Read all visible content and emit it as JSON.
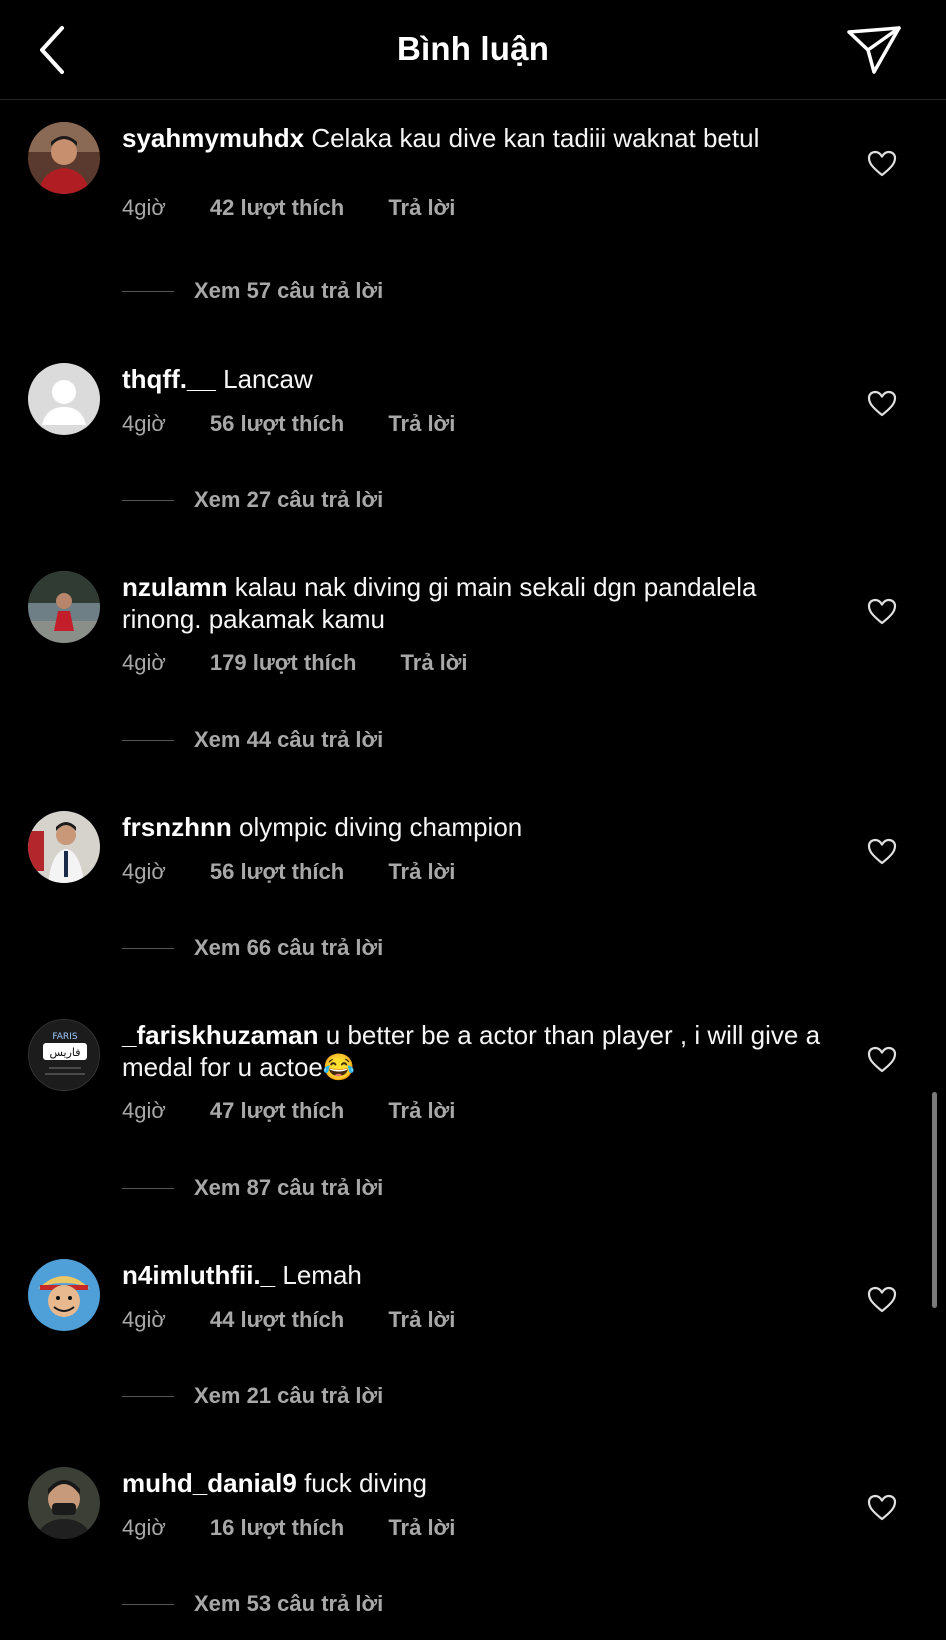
{
  "header": {
    "title": "Bình luận"
  },
  "actions": {
    "like_suffix": "lượt thích",
    "reply_label": "Trả lời"
  },
  "comments": [
    {
      "user": "syahmymuhdx",
      "text": "Celaka kau dive kan tadiii waknat betul",
      "time": "4giờ",
      "likes": "42 lượt thích",
      "reply": "Trả lời",
      "view_replies": "Xem 57 câu trả lời"
    },
    {
      "user": "thqff.__",
      "text": "Lancaw",
      "time": "4giờ",
      "likes": "56 lượt thích",
      "reply": "Trả lời",
      "view_replies": "Xem 27 câu trả lời"
    },
    {
      "user": "nzulamn",
      "text": "kalau nak diving gi main sekali dgn pandalela rinong. pakamak kamu",
      "time": "4giờ",
      "likes": "179 lượt thích",
      "reply": "Trả lời",
      "view_replies": "Xem 44 câu trả lời"
    },
    {
      "user": "frsnzhnn",
      "text": "olympic diving champion",
      "time": "4giờ",
      "likes": "56 lượt thích",
      "reply": "Trả lời",
      "view_replies": "Xem 66 câu trả lời"
    },
    {
      "user": "_fariskhuzaman",
      "text": "u better be a actor than player , i will give a medal for u actoe😂",
      "time": "4giờ",
      "likes": "47 lượt thích",
      "reply": "Trả lời",
      "view_replies": "Xem 87 câu trả lời",
      "avatar_text": "FARIS",
      "avatar_arabic": "فاريس"
    },
    {
      "user": "n4imluthfii._",
      "text": "Lemah",
      "time": "4giờ",
      "likes": "44 lượt thích",
      "reply": "Trả lời",
      "view_replies": "Xem 21 câu trả lời"
    },
    {
      "user": "muhd_danial9",
      "text": "fuck diving",
      "time": "4giờ",
      "likes": "16 lượt thích",
      "reply": "Trả lời",
      "view_replies": "Xem 53 câu trả lời"
    }
  ],
  "colors": {
    "background": "#000000",
    "text": "#ffffff",
    "muted": "#a8a8a8",
    "divider": "#262626"
  },
  "icons": {
    "back": "chevron-left-icon",
    "send": "paper-plane-icon",
    "like": "heart-outline-icon"
  }
}
